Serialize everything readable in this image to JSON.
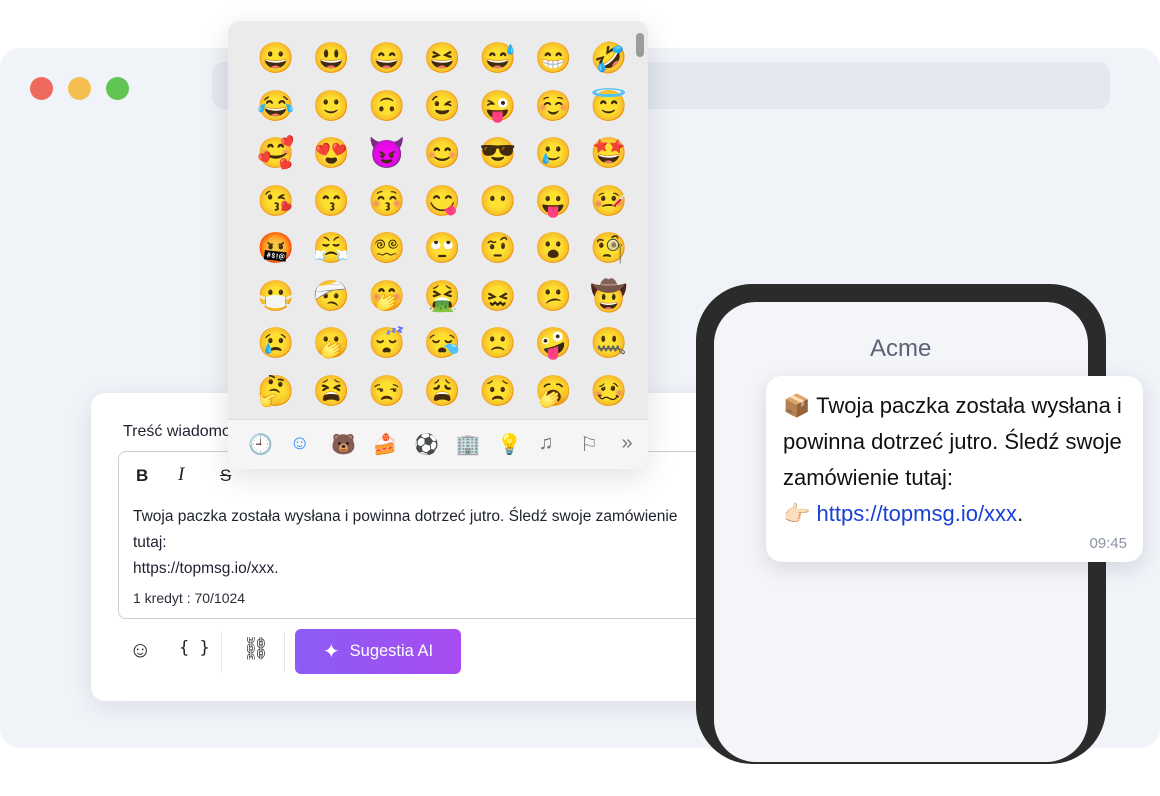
{
  "editor": {
    "label": "Treść wiadomości",
    "format": {
      "bold": "B",
      "italic": "I",
      "strike": "S"
    },
    "message": "Twoja paczka została wysłana i powinna dotrzeć jutro. Śledź swoje zamówienie\ntutaj:\nhttps://topmsg.io/xxx.",
    "counter": "1 kredyt : 70/1024",
    "toolbar": {
      "emoji": "☺",
      "vars": "{ }",
      "link": "⛓",
      "ai_label": "Sugestia AI"
    }
  },
  "emoji_picker": {
    "emojis": [
      "😀",
      "😃",
      "😄",
      "😆",
      "😅",
      "😁",
      "🤣",
      "😂",
      "🙂",
      "🙃",
      "😉",
      "😜",
      "☺️",
      "😇",
      "🥰",
      "😍",
      "😈",
      "😊",
      "😎",
      "🥲",
      "🤩",
      "😘",
      "😙",
      "😚",
      "😋",
      "😶",
      "😛",
      "🤒",
      "🤬",
      "😤",
      "😵‍💫",
      "🙄",
      "🤨",
      "😮",
      "🧐",
      "😷",
      "🤕",
      "🤭",
      "🤮",
      "😖",
      "😕",
      "🤠",
      "😢",
      "🫢",
      "😴",
      "😪",
      "🙁",
      "🤪",
      "🤐",
      "🤔",
      "😫",
      "😒",
      "😩",
      "😟",
      "🥱",
      "🥴"
    ],
    "categories": [
      {
        "name": "recent-icon",
        "glyph": "🕘"
      },
      {
        "name": "smileys-icon",
        "glyph": "☺"
      },
      {
        "name": "animals-icon",
        "glyph": "🐻"
      },
      {
        "name": "food-icon",
        "glyph": "🍰"
      },
      {
        "name": "activity-icon",
        "glyph": "⚽"
      },
      {
        "name": "travel-icon",
        "glyph": "🏢"
      },
      {
        "name": "objects-icon",
        "glyph": "💡"
      },
      {
        "name": "symbols-icon",
        "glyph": "♫"
      },
      {
        "name": "flags-icon",
        "glyph": "⚐"
      },
      {
        "name": "more-icon",
        "glyph": "»"
      }
    ]
  },
  "phone": {
    "contact": "Acme",
    "bubble": {
      "emoji": "📦",
      "text": " Twoja paczka została wysłana i powinna dotrzeć jutro. Śledź swoje zamówienie tutaj:",
      "pointer": "👉🏻",
      "link": "https://topmsg.io/xxx",
      "after_link": ".",
      "time": "09:45"
    }
  }
}
